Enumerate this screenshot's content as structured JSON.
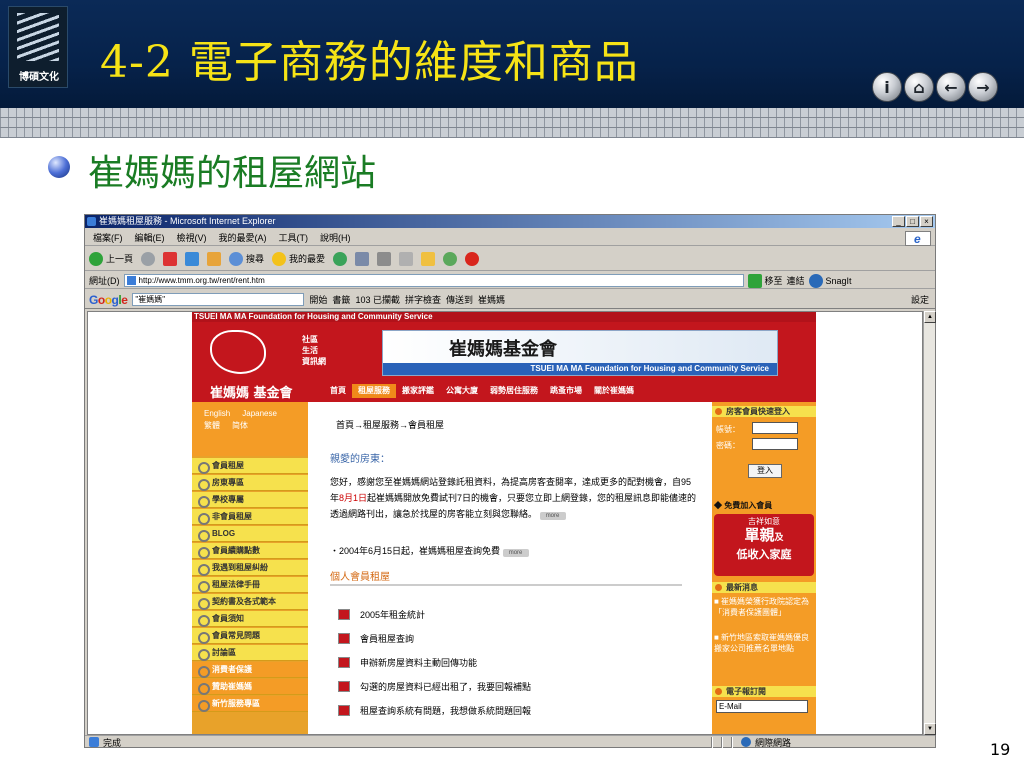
{
  "slide": {
    "logo_text": "博碩文化",
    "title": "4-2 電子商務的維度和商品",
    "subtitle": "崔媽媽的租屋網站",
    "page_number": "19",
    "nav_buttons": [
      "i",
      "⌂",
      "←",
      "→"
    ]
  },
  "browser": {
    "title": "崔媽媽租屋服務 - Microsoft Internet Explorer",
    "window_controls": [
      "_",
      "□",
      "×"
    ],
    "menus": [
      "檔案(F)",
      "編輯(E)",
      "檢視(V)",
      "我的最愛(A)",
      "工具(T)",
      "說明(H)"
    ],
    "toolbar": {
      "back": "上一頁",
      "search": "搜尋",
      "favorites": "我的最愛"
    },
    "address_label": "網址(D)",
    "address": "http://www.tmm.org.tw/rent/rent.htm",
    "go_label": "移至",
    "links_label": "連結",
    "snagit_label": "SnagIt",
    "google": {
      "logo": "Google",
      "query": "\"崔媽媽\"",
      "search_label": "開始",
      "bookmarks_label": "書籤",
      "blocked_label": "103 已攔截",
      "spell_label": "拼字檢查",
      "send_label": "傳送到",
      "highlight_term": "崔媽媽",
      "settings_label": "設定"
    },
    "status": "完成",
    "status_zone": "網際網路"
  },
  "site": {
    "top_strip": "TSUEI MA MA Foundation for Housing and Community Service",
    "banner_social": [
      "社區",
      "生活",
      "資訊網"
    ],
    "banner_cn": "崔媽媽基金會",
    "banner_en": "TSUEI MA MA Foundation for Housing and Community Service",
    "nav_brand": "崔媽媽 基金會",
    "nav": [
      "首頁",
      "租屋服務",
      "搬家評鑑",
      "公寓大廈",
      "弱勢居住服務",
      "跳蚤市場",
      "關於崔媽媽"
    ],
    "lang": {
      "english": "English",
      "japanese": "Japanese",
      "trad": "繁體",
      "simp": "简体"
    },
    "sidebar": [
      "會員租屋",
      "房東專區",
      "學校專屬",
      "非會員租屋",
      "BLOG",
      "會員續購點數",
      "我遇到租屋糾紛",
      "租屋法律手冊",
      "契約書及各式範本",
      "會員須知",
      "會員常見問題",
      "討論區"
    ],
    "sidebar_alt": [
      "消費者保護",
      "贊助崔媽媽",
      "新竹服務專區"
    ],
    "breadcrumb": "首頁→租屋服務→會員租屋",
    "greeting": "親愛的房東：",
    "para_1": "您好，感謝您至崔媽媽網站登錄託租資料，為提高房客查閱率，達成更多的配對機會，自95年",
    "para_hl": "8月1日",
    "para_2": "起崔媽媽開放免費試刊7日的機會，只要您立即上網登錄，您的租屋訊息即能儘速的透過網路刊出，讓急於找屋的房客能立刻與您聯絡。",
    "more_label": "more",
    "notice": "・2004年6月15日起，崔媽媽租屋查詢免費",
    "section_title": "個人會員租屋",
    "links": [
      "2005年租金統計",
      "會員租屋查詢",
      "申辦新房屋資料主動回傳功能",
      "勾選的房屋資料已經出租了，我要回報補點",
      "租屋查詢系統有問題，我想做系統問題回報"
    ],
    "right": {
      "login_head": "房客會員快速登入",
      "account_label": "帳號：",
      "password_label": "密碼：",
      "login_button": "登入",
      "join": "◆ 免費加入會員",
      "promo_sub": "吉祥如意",
      "promo_main": "單親",
      "promo_suffix": "及",
      "promo_tag": "低收入家庭",
      "news_head": "最新消息",
      "news": [
        "■ 崔媽媽榮獲行政院認定為「消費者保護團體」",
        "■ 新竹地區索取崔媽媽優良搬家公司推薦名單地點"
      ],
      "epaper_head": "電子報訂閱",
      "email_placeholder": "E-Mail"
    }
  },
  "colors": {
    "title_yellow": "#f6e316",
    "subtitle_green": "#1a7c24",
    "brand_red": "#c3161d",
    "orange": "#f49c26"
  }
}
